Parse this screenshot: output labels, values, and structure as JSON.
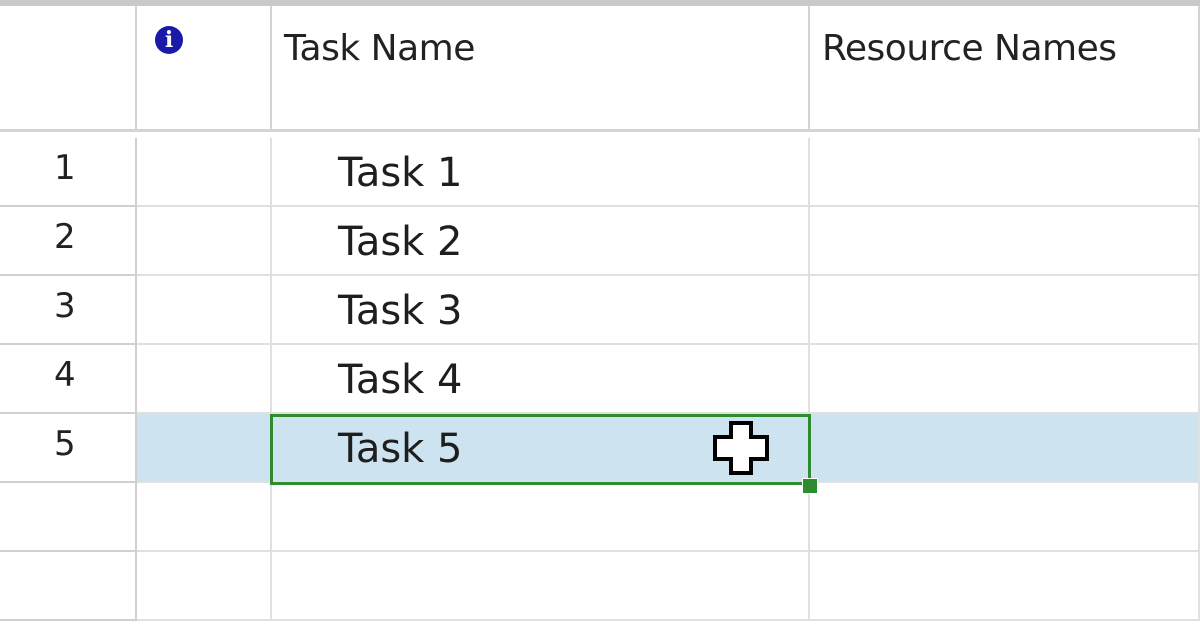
{
  "header": {
    "indicators_icon": "info-icon",
    "indicators_glyph": "i",
    "task_name": "Task Name",
    "resource_names": "Resource Names"
  },
  "rows": [
    {
      "id": "1",
      "task": "Task 1",
      "resources": ""
    },
    {
      "id": "2",
      "task": "Task 2",
      "resources": ""
    },
    {
      "id": "3",
      "task": "Task 3",
      "resources": ""
    },
    {
      "id": "4",
      "task": "Task 4",
      "resources": ""
    },
    {
      "id": "5",
      "task": "Task 5",
      "resources": ""
    },
    {
      "id": "",
      "task": "",
      "resources": ""
    },
    {
      "id": "",
      "task": "",
      "resources": ""
    }
  ],
  "selection": {
    "selected_row": "5",
    "active_column": "Task Name",
    "cursor": "cross-select-cursor-icon"
  },
  "colors": {
    "selection_row": "#cde3f0",
    "active_cell_border": "#2e8b2e",
    "info_icon": "#1a1aa8"
  }
}
